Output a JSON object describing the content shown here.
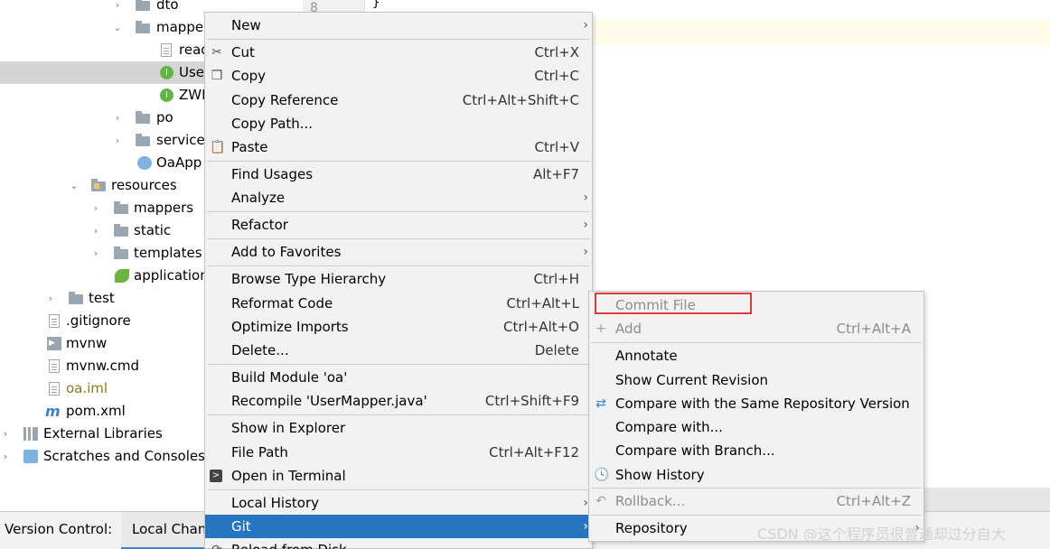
{
  "editor": {
    "line_number": "8",
    "code": "}"
  },
  "tree": {
    "items": [
      {
        "label": "dto",
        "arrow": "›",
        "kind": "folder"
      },
      {
        "label": "mappe",
        "arrow": "⌄",
        "kind": "folder"
      },
      {
        "label": "read",
        "arrow": "",
        "kind": "file"
      },
      {
        "label": "Use",
        "arrow": "",
        "kind": "interface",
        "badge": "I"
      },
      {
        "label": "ZWI",
        "arrow": "",
        "kind": "interface",
        "badge": "I"
      },
      {
        "label": "po",
        "arrow": "›",
        "kind": "folder"
      },
      {
        "label": "service",
        "arrow": "›",
        "kind": "folder"
      },
      {
        "label": "OaApp",
        "arrow": "",
        "kind": "app"
      },
      {
        "label": "resources",
        "arrow": "⌄",
        "kind": "resfolder"
      },
      {
        "label": "mappers",
        "arrow": "›",
        "kind": "folder"
      },
      {
        "label": "static",
        "arrow": "›",
        "kind": "folder"
      },
      {
        "label": "templates",
        "arrow": "›",
        "kind": "folder"
      },
      {
        "label": "application",
        "arrow": "",
        "kind": "spring"
      },
      {
        "label": "test",
        "arrow": "›",
        "kind": "folder"
      },
      {
        "label": ".gitignore",
        "arrow": "",
        "kind": "file"
      },
      {
        "label": "mvnw",
        "arrow": "",
        "kind": "cmd"
      },
      {
        "label": "mvnw.cmd",
        "arrow": "",
        "kind": "file"
      },
      {
        "label": "oa.iml",
        "arrow": "",
        "kind": "file"
      },
      {
        "label": "pom.xml",
        "arrow": "",
        "kind": "maven",
        "badge": "m"
      },
      {
        "label": "External Libraries",
        "arrow": "›",
        "kind": "lib"
      },
      {
        "label": "Scratches and Consoles",
        "arrow": "›",
        "kind": "scratch"
      }
    ]
  },
  "context_menu": {
    "items": {
      "new": {
        "label": "New"
      },
      "cut": {
        "label": "Cut",
        "shortcut": "Ctrl+X"
      },
      "copy": {
        "label": "Copy",
        "shortcut": "Ctrl+C"
      },
      "copy_reference": {
        "label": "Copy Reference",
        "shortcut": "Ctrl+Alt+Shift+C"
      },
      "copy_path": {
        "label": "Copy Path..."
      },
      "paste": {
        "label": "Paste",
        "shortcut": "Ctrl+V"
      },
      "find_usages": {
        "label": "Find Usages",
        "shortcut": "Alt+F7"
      },
      "analyze": {
        "label": "Analyze"
      },
      "refactor": {
        "label": "Refactor"
      },
      "add_to_favorites": {
        "label": "Add to Favorites"
      },
      "browse_type_hierarchy": {
        "label": "Browse Type Hierarchy",
        "shortcut": "Ctrl+H"
      },
      "reformat_code": {
        "label": "Reformat Code",
        "shortcut": "Ctrl+Alt+L"
      },
      "optimize_imports": {
        "label": "Optimize Imports",
        "shortcut": "Ctrl+Alt+O"
      },
      "delete": {
        "label": "Delete...",
        "shortcut": "Delete"
      },
      "build_module": {
        "label": "Build Module 'oa'"
      },
      "recompile": {
        "label": "Recompile 'UserMapper.java'",
        "shortcut": "Ctrl+Shift+F9"
      },
      "show_in_explorer": {
        "label": "Show in Explorer"
      },
      "file_path": {
        "label": "File Path",
        "shortcut": "Ctrl+Alt+F12"
      },
      "open_in_terminal": {
        "label": "Open in Terminal"
      },
      "local_history": {
        "label": "Local History"
      },
      "git": {
        "label": "Git"
      },
      "reload_from_disk": {
        "label": "Reload from Disk"
      }
    }
  },
  "git_submenu": {
    "items": {
      "commit_file": {
        "label": "Commit File"
      },
      "add": {
        "label": "Add",
        "shortcut": "Ctrl+Alt+A"
      },
      "annotate": {
        "label": "Annotate"
      },
      "show_current_revision": {
        "label": "Show Current Revision"
      },
      "compare_same_repo": {
        "label": "Compare with the Same Repository Version"
      },
      "compare_with": {
        "label": "Compare with..."
      },
      "compare_with_branch": {
        "label": "Compare with Branch..."
      },
      "show_history": {
        "label": "Show History"
      },
      "rollback": {
        "label": "Rollback...",
        "shortcut": "Ctrl+Alt+Z"
      },
      "repository": {
        "label": "Repository"
      }
    }
  },
  "bottom_bar": {
    "version_control": "Version Control:",
    "local_changes": "Local Chan"
  },
  "watermark": "CSDN @这个程序员很普通却过分自大",
  "colors": {
    "selection": "#2675bf",
    "highlight_box": "#e03a3a",
    "menu_bg": "#f2f2f2"
  }
}
